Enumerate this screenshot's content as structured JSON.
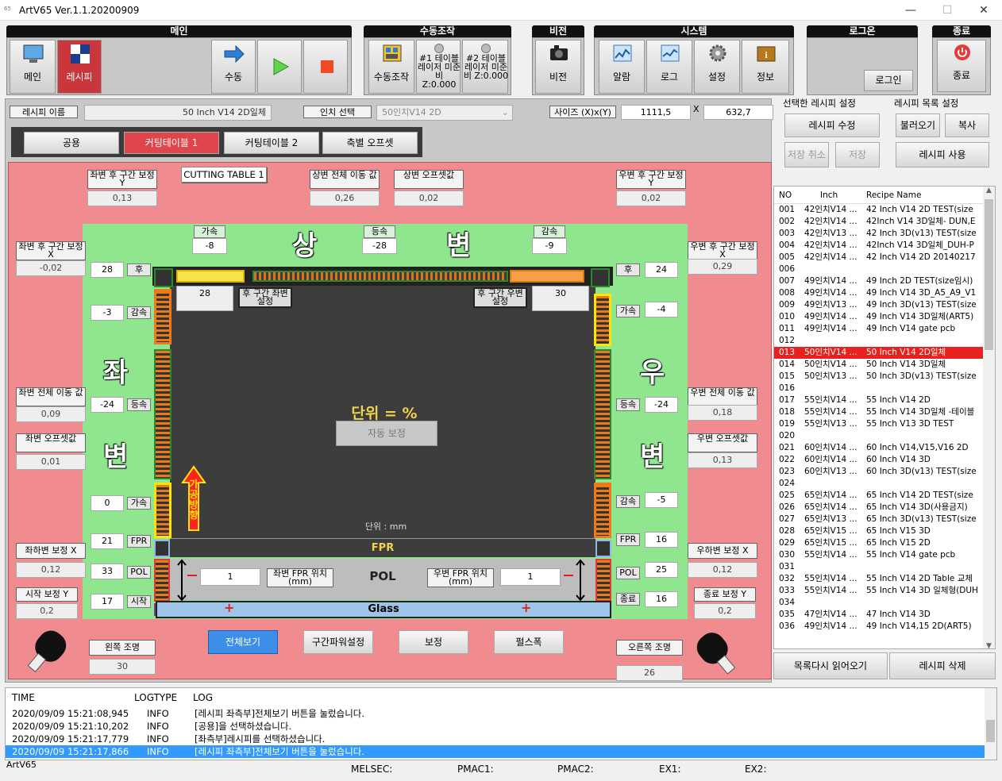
{
  "window": {
    "title": "ArtV65 Ver.1.1.20200909",
    "icon_text": "65",
    "min": "—",
    "max": "☐",
    "close": "✕"
  },
  "groups": {
    "main": "메인",
    "manual": "수동조작",
    "vision": "비전",
    "system": "시스템",
    "login": "로그온",
    "exit": "종료"
  },
  "toolbar": {
    "main": "메인",
    "recipe": "레시피",
    "manual": "수동",
    "manual_op": "수동조작",
    "t1": "#1 테이블 레이저 미준비 Z:0.000",
    "t2": "#2 테이블 레이저 미준비 Z:0.000",
    "vision": "비전",
    "alarm": "알람",
    "log": "로그",
    "settings": "설정",
    "info": "정보",
    "login_btn": "로그인",
    "exit": "종료"
  },
  "recipe_bar": {
    "name_label": "레시피 이름",
    "name_value": "50 Inch V14 2D일체",
    "inch_label": "인치 선택",
    "inch_value": "50인치V14 2D",
    "size_label": "사이즈 (X)x(Y)",
    "size_x": "1111,5",
    "x_sep": "X",
    "size_y": "632,7"
  },
  "tabs": [
    "공용",
    "커팅테이블 1",
    "커팅테이블 2",
    "축별 오프셋"
  ],
  "recipe_settings": {
    "title": "선택한 레시피 설정",
    "edit": "레시피 수정",
    "cancel": "저장 취소",
    "save": "저장"
  },
  "list_settings": {
    "title": "레시피 목록 설정",
    "load": "불러오기",
    "copy": "복사",
    "use": "레시피 사용"
  },
  "table": {
    "title": "CUTTING TABLE 1",
    "top_left_corr": {
      "label": "좌변 후 구간 보정 Y",
      "value": "0,13"
    },
    "top_total": {
      "label": "상변 전체 이동 값",
      "value": "0,26"
    },
    "top_offset": {
      "label": "상변 오프셋값",
      "value": "0,02"
    },
    "top_right_corr": {
      "label": "우변 후 구간 보정 Y",
      "value": "0,02"
    },
    "left_corr_x": {
      "label": "좌변 후 구간 보정 X",
      "value": "-0,02"
    },
    "right_corr_x": {
      "label": "우변 후 구간 보정 X",
      "value": "0,29"
    },
    "left_total": {
      "label": "좌변 전체 이동 값",
      "value": "0,09"
    },
    "left_offset": {
      "label": "좌변 오프셋값",
      "value": "0,01"
    },
    "right_total": {
      "label": "우변 전체 이동 값",
      "value": "0,18"
    },
    "right_offset": {
      "label": "우변 오프셋값",
      "value": "0,13"
    },
    "bl_corr": {
      "label": "좌하변 보정 X",
      "value": "0,12"
    },
    "br_corr": {
      "label": "우하변 보정 X",
      "value": "0,12"
    },
    "start_corr": {
      "label": "시작 보정 Y",
      "value": "0,2"
    },
    "end_corr": {
      "label": "종료 보정 Y",
      "value": "0,2"
    },
    "top_accel": {
      "label": "가속",
      "value": "-8"
    },
    "top_const": {
      "label": "등속",
      "value": "-28"
    },
    "top_decel": {
      "label": "감속",
      "value": "-9"
    },
    "top_left_seg": "28",
    "top_right_seg": "30",
    "left_rear": {
      "label": "후",
      "value": "28"
    },
    "left_decel": {
      "label": "감속",
      "value": "-3"
    },
    "left_const": {
      "label": "등속",
      "value": "-24"
    },
    "left_accel": {
      "label": "가속",
      "value": "0"
    },
    "left_fpr": {
      "label": "FPR",
      "value": "21"
    },
    "left_pol": {
      "label": "POL",
      "value": "33"
    },
    "left_start": {
      "label": "시작",
      "value": "17"
    },
    "right_rear": {
      "label": "후",
      "value": "24"
    },
    "right_accel": {
      "label": "가속",
      "value": "-4"
    },
    "right_const": {
      "label": "등속",
      "value": "-24"
    },
    "right_decel": {
      "label": "감속",
      "value": "-5"
    },
    "right_fpr": {
      "label": "FPR",
      "value": "16"
    },
    "right_pol": {
      "label": "POL",
      "value": "25"
    },
    "right_end": {
      "label": "종료",
      "value": "16"
    },
    "left_rear_btn": "후 구간 좌변 설정",
    "right_rear_btn": "후 구간 우변 설정",
    "side_top": [
      "상",
      "변"
    ],
    "side_left": [
      "좌",
      "변"
    ],
    "side_right": [
      "우",
      "변"
    ],
    "unit": "단위 = %",
    "auto_btn": "자동 보정",
    "direction": "가공방향",
    "unit_mm": "단위 : mm",
    "fpr": "FPR",
    "pol": "POL",
    "glass": "Glass",
    "left_fpr_pos": {
      "label": "좌변 FPR 위치(mm)",
      "value": "1"
    },
    "right_fpr_pos": {
      "label": "우변 FPR 위치(mm)",
      "value": "1"
    },
    "left_light": {
      "label": "왼쪽 조명",
      "value": "30"
    },
    "right_light": {
      "label": "오른쪽 조명",
      "value": "26"
    },
    "btn_view": "전체보기",
    "btn_power": "구간파워설정",
    "btn_corr": "보정",
    "btn_pulse": "펄스폭"
  },
  "recipe_list": {
    "headers": [
      "NO",
      "Inch",
      "Recipe Name"
    ],
    "rows": [
      [
        "001",
        "42인치V14 ...",
        "42 Inch V14 2D TEST(size"
      ],
      [
        "002",
        "42인치V14 ...",
        "42Inch V14 3D일체- DUN,E"
      ],
      [
        "003",
        "42인치V13 ...",
        "42 Inch 3D(v13) TEST(size"
      ],
      [
        "004",
        "42인치V14 ...",
        "42Inch V14 3D일체_DUH-P"
      ],
      [
        "005",
        "42인치V14 ...",
        "42 Inch V14 2D 20140217"
      ],
      [
        "006",
        "",
        ""
      ],
      [
        "007",
        "49인치V14 ...",
        "49 Inch 2D TEST(size임시)"
      ],
      [
        "008",
        "49인치V14 ...",
        "49 Inch V14 3D_A5_A9_V1"
      ],
      [
        "009",
        "49인치V13 ...",
        "49 Inch 3D(v13) TEST(size"
      ],
      [
        "010",
        "49인치V14 ...",
        "49 Inch V14 3D일체(ART5)"
      ],
      [
        "011",
        "49인치V14 ...",
        "49 Inch V14 gate pcb"
      ],
      [
        "012",
        "",
        ""
      ],
      [
        "013",
        "50인치V14 ...",
        "50 Inch V14 2D일체"
      ],
      [
        "014",
        "50인치V14 ...",
        "50 Inch V14 3D일체"
      ],
      [
        "015",
        "50인치V13 ...",
        "50 Inch 3D(v13) TEST(size"
      ],
      [
        "016",
        "",
        ""
      ],
      [
        "017",
        "55인치V14 ...",
        "55 Inch V14 2D"
      ],
      [
        "018",
        "55인치V14 ...",
        "55 Inch V14 3D일체 -테이블"
      ],
      [
        "019",
        "55인치V13 ...",
        "55 Inch V13 3D TEST"
      ],
      [
        "020",
        "",
        ""
      ],
      [
        "021",
        "60인치V14 ...",
        "60 Inch V14,V15,V16 2D"
      ],
      [
        "022",
        "60인치V14 ...",
        "60 Inch V14 3D"
      ],
      [
        "023",
        "60인치V13 ...",
        "60 Inch 3D(v13) TEST(size"
      ],
      [
        "024",
        "",
        ""
      ],
      [
        "025",
        "65인치V14 ...",
        "65 Inch V14 2D TEST(size"
      ],
      [
        "026",
        "65인치V14 ...",
        "65 Inch V14 3D(사용금지)"
      ],
      [
        "027",
        "65인치V13 ...",
        "65 Inch 3D(v13) TEST(size"
      ],
      [
        "028",
        "65인치V15 ...",
        "65 Inch V15 3D"
      ],
      [
        "029",
        "65인치V15 ...",
        "65 Inch V15 2D"
      ],
      [
        "030",
        "55인치V14 ...",
        "55 Inch V14 gate pcb"
      ],
      [
        "031",
        "",
        ""
      ],
      [
        "032",
        "55인치V14 ...",
        "55 Inch V14 2D Table 교체"
      ],
      [
        "033",
        "55인치V14 ...",
        "55 Inch V14 3D 일체형(DUH"
      ],
      [
        "034",
        "",
        ""
      ],
      [
        "035",
        "47인치V14 ...",
        "47 Inch V14 3D"
      ],
      [
        "036",
        "49인치V14 ...",
        "49 Inch V14,15 2D(ART5)"
      ]
    ],
    "selected": "013",
    "reload": "목록다시 읽어오기",
    "delete": "레시피 삭제"
  },
  "log": {
    "headers": [
      "TIME",
      "LOGTYPE",
      "LOG"
    ],
    "rows": [
      [
        "2020/09/09 15:21:08,945",
        "INFO",
        "[레시피 좌측부]전체보기 버튼을 눌렀습니다."
      ],
      [
        "2020/09/09 15:21:10,202",
        "INFO",
        "[공용]을 선택하셨습니다."
      ],
      [
        "2020/09/09 15:21:17,779",
        "INFO",
        "[좌측부]레시피를 선택하셨습니다."
      ],
      [
        "2020/09/09 15:21:17,866",
        "INFO",
        "[레시피 좌측부]전체보기 버튼을 눌렀습니다."
      ]
    ]
  },
  "status": {
    "app": "ArtV65",
    "melsec": "MELSEC:",
    "pmac1": "PMAC1:",
    "pmac2": "PMAC2:",
    "ex1": "EX1:",
    "ex2": "EX2:"
  },
  "colors": {
    "pink": "#f08b8f",
    "green": "#8fe68f",
    "selected_row": "#e8201e",
    "selected_tab": "#c9363c",
    "log_selected": "#3399ff",
    "view_btn": "#3d8ee8"
  }
}
